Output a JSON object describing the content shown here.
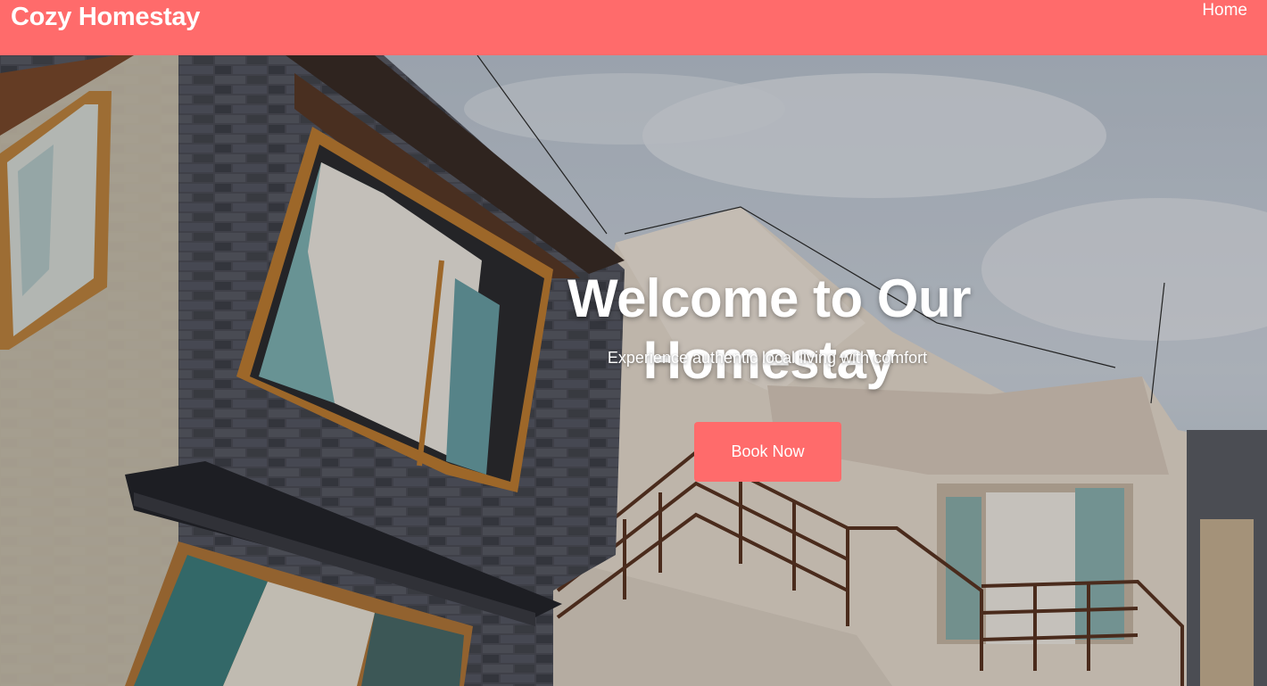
{
  "navbar": {
    "brand": "Cozy Homestay",
    "links": [
      {
        "label": "Home"
      }
    ],
    "color": "#ff6b6b"
  },
  "hero": {
    "title": "Welcome to Our Homestay",
    "subtitle": "Experience authentic local living with comfort",
    "cta_label": "Book Now",
    "cta_color": "#ff6b6b"
  }
}
